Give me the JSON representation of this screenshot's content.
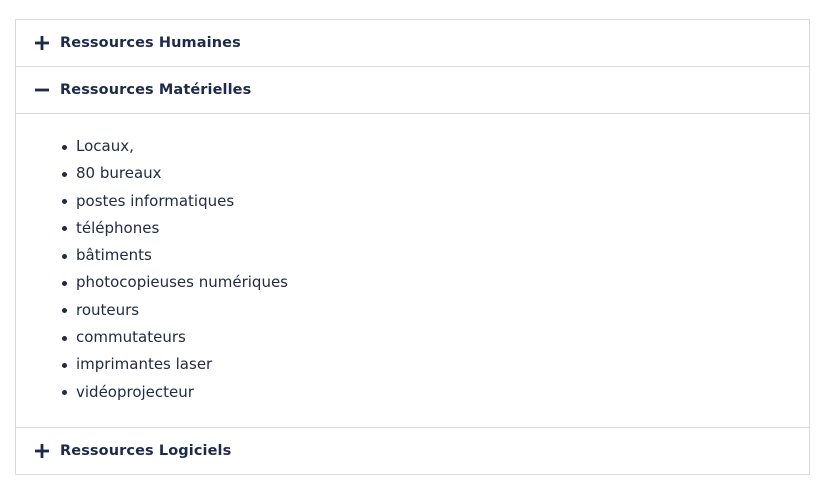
{
  "accordion": {
    "items": [
      {
        "title": "Ressources Humaines",
        "icon": "plus-icon",
        "expanded": false
      },
      {
        "title": "Ressources Matérielles",
        "icon": "minus-icon",
        "expanded": true,
        "list": [
          "Locaux,",
          "80 bureaux",
          "postes informatiques",
          "téléphones",
          "bâtiments",
          "photocopieuses numériques",
          "routeurs",
          "commutateurs",
          "imprimantes laser",
          "vidéoprojecteur"
        ]
      },
      {
        "title": "Ressources Logiciels",
        "icon": "plus-icon",
        "expanded": false
      }
    ]
  },
  "colors": {
    "text": "#1e2a4a",
    "border": "#d9d9d9",
    "background": "#ffffff"
  }
}
